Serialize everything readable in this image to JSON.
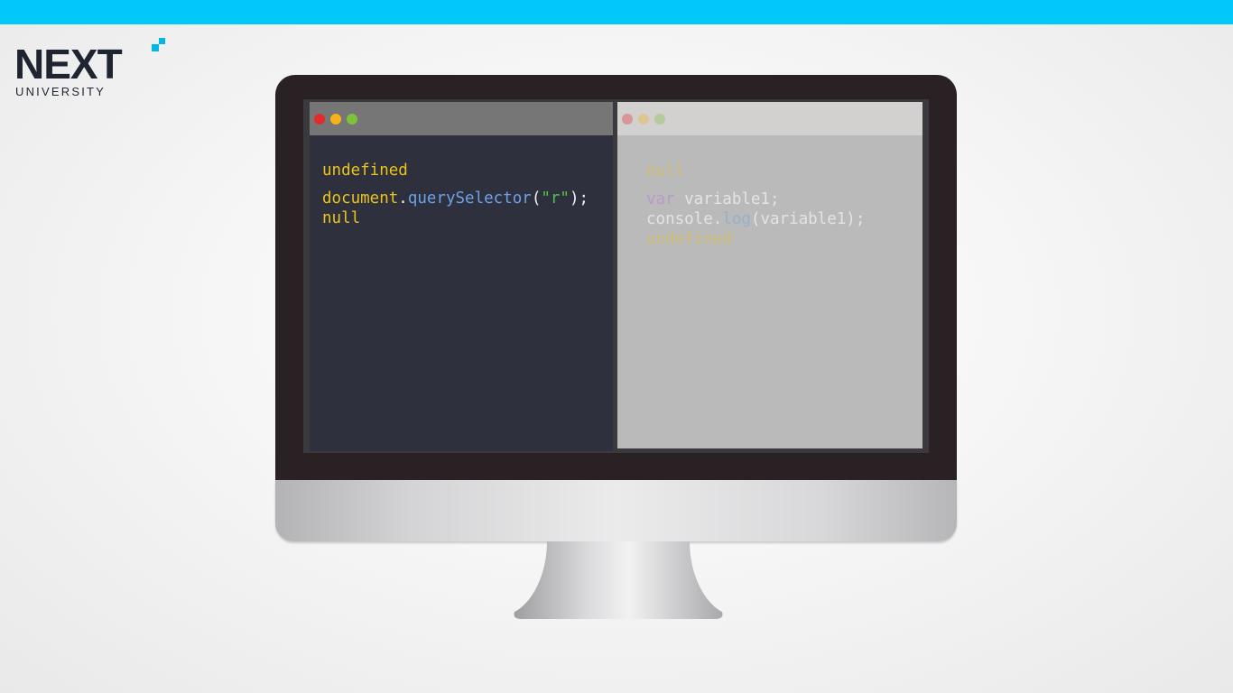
{
  "colors": {
    "top_bar": "#00c8f8",
    "logo_accent": "#00b7e6",
    "left_window_bg": "#2f303d",
    "left_titlebar": "#767676",
    "right_window_bg": "#bababa",
    "right_titlebar": "#d3d0d0",
    "code_yellow": "#e9c41c",
    "code_white": "#f2f2f2",
    "code_blue": "#6ba2e8",
    "code_green": "#53c34a",
    "code_purple": "#b46be0",
    "dot_red": "#e32b2b",
    "dot_yellow": "#f6b21a",
    "dot_green": "#7cc23b"
  },
  "logo": {
    "wordmark": "NEXT",
    "subtitle": "UNIVERSITY"
  },
  "left_window": {
    "dots": [
      "red-dot-icon",
      "yellow-dot-icon",
      "green-dot-icon"
    ],
    "line1": "undefined",
    "line2": {
      "object": "document",
      "dot": ".",
      "method": "querySelector",
      "open": "(",
      "arg": "\"r\"",
      "close": ");"
    },
    "line3": "null"
  },
  "right_window": {
    "dots": [
      "red-dot-icon",
      "yellow-dot-icon",
      "green-dot-icon"
    ],
    "line1": "null",
    "line2": {
      "keyword": "var",
      "rest": " variable1;"
    },
    "line3": {
      "object": "console",
      "dot": ".",
      "method": "log",
      "rest": "(variable1);"
    },
    "line4": "undefined"
  }
}
